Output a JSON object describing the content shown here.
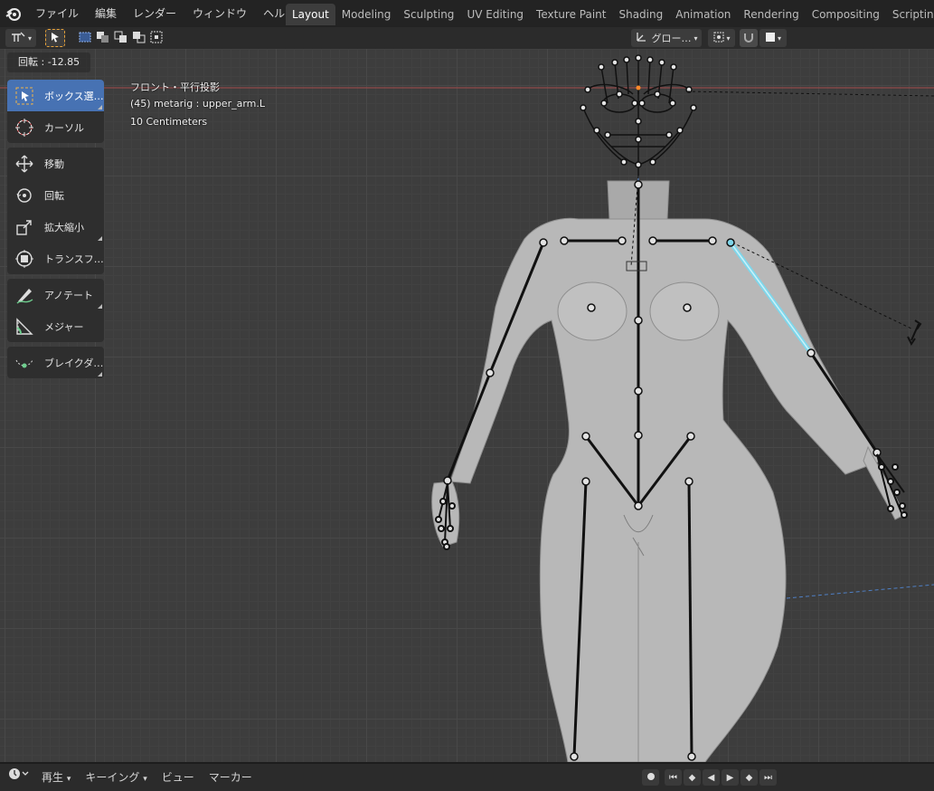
{
  "topbar": {
    "menus": [
      "ファイル",
      "編集",
      "レンダー",
      "ウィンドウ",
      "ヘルプ"
    ],
    "tabs": [
      {
        "label": "Layout",
        "active": true
      },
      {
        "label": "Modeling"
      },
      {
        "label": "Sculpting"
      },
      {
        "label": "UV Editing"
      },
      {
        "label": "Texture Paint"
      },
      {
        "label": "Shading"
      },
      {
        "label": "Animation"
      },
      {
        "label": "Rendering"
      },
      {
        "label": "Compositing"
      },
      {
        "label": "Scripting"
      }
    ],
    "add_tab_label": "+"
  },
  "viewport_header": {
    "orientation_label": "グロー…",
    "pivot_icon": "pivot-icon",
    "snap_icon": "magnet-icon"
  },
  "operator_panel": {
    "label": "回転 : -12.85"
  },
  "toolbar": {
    "tools": [
      {
        "id": "box-select",
        "label": "ボックス選…",
        "active": true,
        "icon": "select-box-icon"
      },
      {
        "id": "cursor",
        "label": "カーソル",
        "icon": "cursor-icon"
      },
      {
        "id": "move",
        "label": "移動",
        "icon": "move-icon"
      },
      {
        "id": "rotate",
        "label": "回転",
        "icon": "rotate-icon"
      },
      {
        "id": "scale",
        "label": "拡大縮小",
        "icon": "scale-icon"
      },
      {
        "id": "transform",
        "label": "トランスフ…",
        "icon": "transform-icon"
      },
      {
        "id": "annotate",
        "label": "アノテート",
        "icon": "annotate-icon"
      },
      {
        "id": "measure",
        "label": "メジャー",
        "icon": "measure-icon"
      },
      {
        "id": "breakdown",
        "label": "ブレイクダ…",
        "icon": "breakdown-icon"
      }
    ]
  },
  "viewport_overlay": {
    "view_name": "フロント・平行投影",
    "object_info": "(45) metarig : upper_arm.L",
    "grid_scale": "10 Centimeters"
  },
  "bottombar": {
    "playback_label": "再生",
    "keying_label": "キーイング",
    "view_label": "ビュー",
    "marker_label": "マーカー"
  },
  "colors": {
    "accent": "#4772b3",
    "selected_bone": "#7fd6ea",
    "mesh": "#b9b9b9",
    "grid": "#3d3d3d"
  }
}
